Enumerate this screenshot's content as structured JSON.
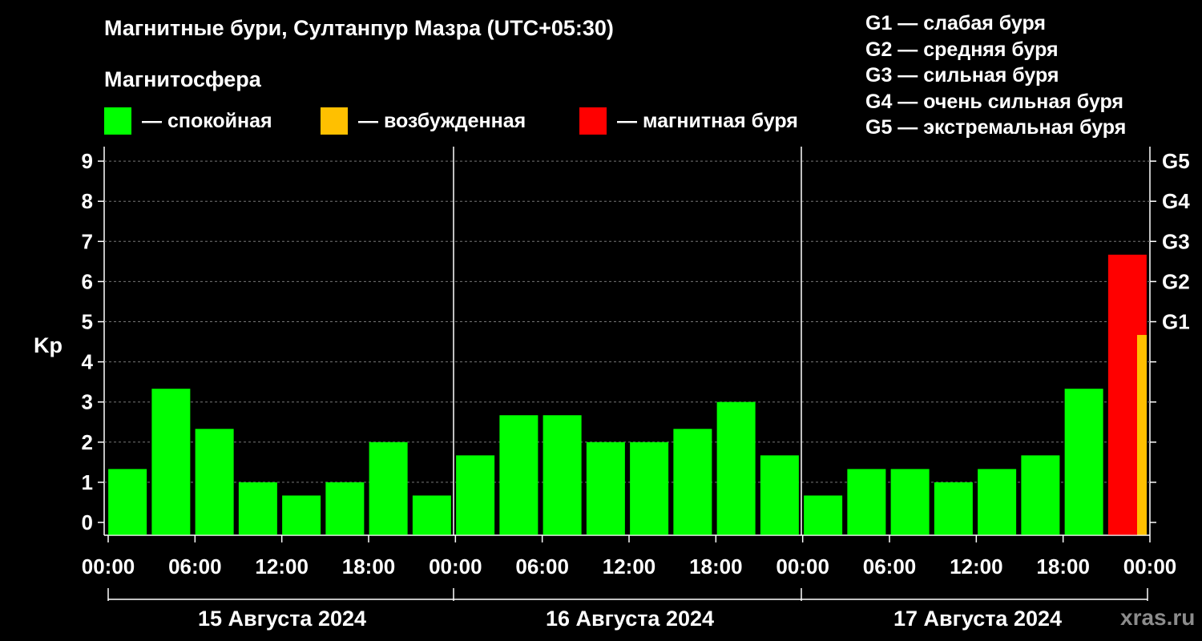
{
  "header": {
    "title": "Магнитные бури, Султанпур Мазра (UTC+05:30)",
    "subtitle": "Магнитосфера"
  },
  "legend": [
    {
      "label": "— спокойная",
      "color": "#00ff00"
    },
    {
      "label": "— возбужденная",
      "color": "#ffc000"
    },
    {
      "label": "— магнитная буря",
      "color": "#ff0000"
    }
  ],
  "storm_scale": [
    "G1 — слабая буря",
    "G2 — средняя буря",
    "G3 — сильная буря",
    "G4 — очень сильная буря",
    "G5 — экстремальная буря"
  ],
  "credit": "xras.ru",
  "chart_data": {
    "type": "bar",
    "ylabel": "Kp",
    "ylim": [
      0,
      9
    ],
    "yticks": [
      0,
      1,
      2,
      3,
      4,
      5,
      6,
      7,
      8,
      9
    ],
    "right_ticks": [
      {
        "kp": 5,
        "label": "G1"
      },
      {
        "kp": 6,
        "label": "G2"
      },
      {
        "kp": 7,
        "label": "G3"
      },
      {
        "kp": 8,
        "label": "G4"
      },
      {
        "kp": 9,
        "label": "G5"
      }
    ],
    "grid": "horizontal dashed",
    "xtick_labels": [
      "00:00",
      "06:00",
      "12:00",
      "18:00",
      "00:00",
      "06:00",
      "12:00",
      "18:00",
      "00:00",
      "06:00",
      "12:00",
      "18:00",
      "00:00"
    ],
    "days": [
      "15 Августа 2024",
      "16 Августа 2024",
      "17 Августа 2024"
    ],
    "colors": {
      "quiet": "#00ff00",
      "active": "#ffc000",
      "storm": "#ff0000"
    },
    "bars": [
      {
        "start_hour": 0,
        "kp": 1.33,
        "level": "quiet"
      },
      {
        "start_hour": 3,
        "kp": 3.33,
        "level": "quiet"
      },
      {
        "start_hour": 6,
        "kp": 2.33,
        "level": "quiet"
      },
      {
        "start_hour": 9,
        "kp": 1.0,
        "level": "quiet"
      },
      {
        "start_hour": 12,
        "kp": 0.67,
        "level": "quiet"
      },
      {
        "start_hour": 15,
        "kp": 1.0,
        "level": "quiet"
      },
      {
        "start_hour": 18,
        "kp": 2.0,
        "level": "quiet"
      },
      {
        "start_hour": 21,
        "kp": 0.67,
        "level": "quiet"
      },
      {
        "start_hour": 24,
        "kp": 1.67,
        "level": "quiet"
      },
      {
        "start_hour": 27,
        "kp": 2.67,
        "level": "quiet"
      },
      {
        "start_hour": 30,
        "kp": 2.67,
        "level": "quiet"
      },
      {
        "start_hour": 33,
        "kp": 2.0,
        "level": "quiet"
      },
      {
        "start_hour": 36,
        "kp": 2.0,
        "level": "quiet"
      },
      {
        "start_hour": 39,
        "kp": 2.33,
        "level": "quiet"
      },
      {
        "start_hour": 42,
        "kp": 3.0,
        "level": "quiet"
      },
      {
        "start_hour": 45,
        "kp": 1.67,
        "level": "quiet"
      },
      {
        "start_hour": 48,
        "kp": 0.67,
        "level": "quiet"
      },
      {
        "start_hour": 51,
        "kp": 1.33,
        "level": "quiet"
      },
      {
        "start_hour": 54,
        "kp": 1.33,
        "level": "quiet"
      },
      {
        "start_hour": 57,
        "kp": 1.0,
        "level": "quiet"
      },
      {
        "start_hour": 60,
        "kp": 1.33,
        "level": "quiet"
      },
      {
        "start_hour": 63,
        "kp": 1.67,
        "level": "quiet"
      },
      {
        "start_hour": 66,
        "kp": 3.33,
        "level": "quiet"
      },
      {
        "start_hour": 69,
        "kp": 6.67,
        "level": "storm"
      },
      {
        "start_hour": 72,
        "kp": 4.67,
        "level": "active",
        "partial": true
      }
    ]
  }
}
